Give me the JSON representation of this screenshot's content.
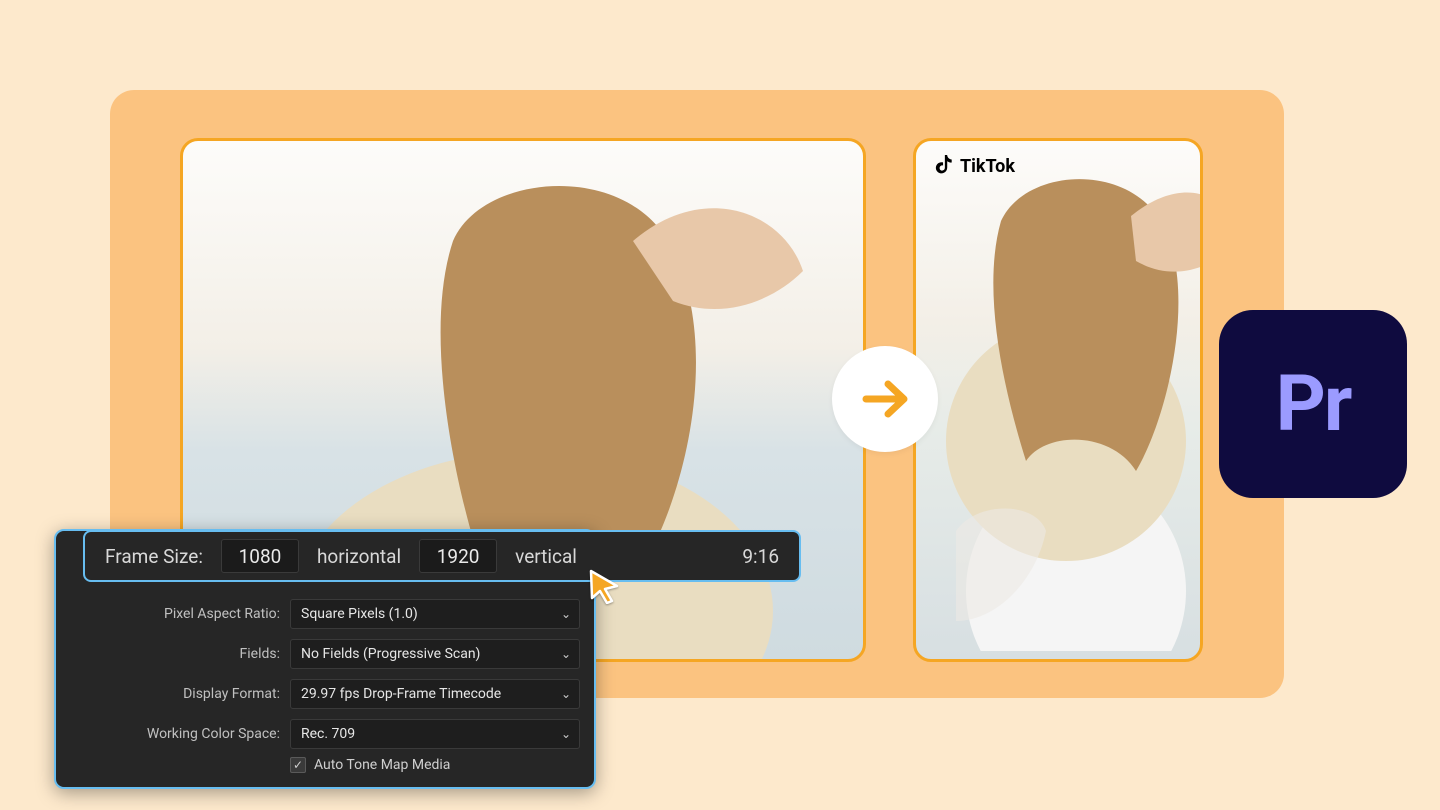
{
  "tiktok": {
    "label": "TikTok"
  },
  "pr": {
    "label": "Pr"
  },
  "frameSize": {
    "label": "Frame Size:",
    "width": "1080",
    "hLabel": "horizontal",
    "height": "1920",
    "vLabel": "vertical",
    "aspect": "9:16"
  },
  "settings": {
    "pixelAspect": {
      "label": "Pixel Aspect Ratio:",
      "value": "Square Pixels (1.0)"
    },
    "fields": {
      "label": "Fields:",
      "value": "No Fields (Progressive Scan)"
    },
    "displayFmt": {
      "label": "Display Format:",
      "value": "29.97 fps Drop-Frame Timecode"
    },
    "colorSpace": {
      "label": "Working Color Space:",
      "value": "Rec. 709"
    },
    "autoTone": {
      "label": "Auto Tone Map Media",
      "checked": true
    }
  }
}
